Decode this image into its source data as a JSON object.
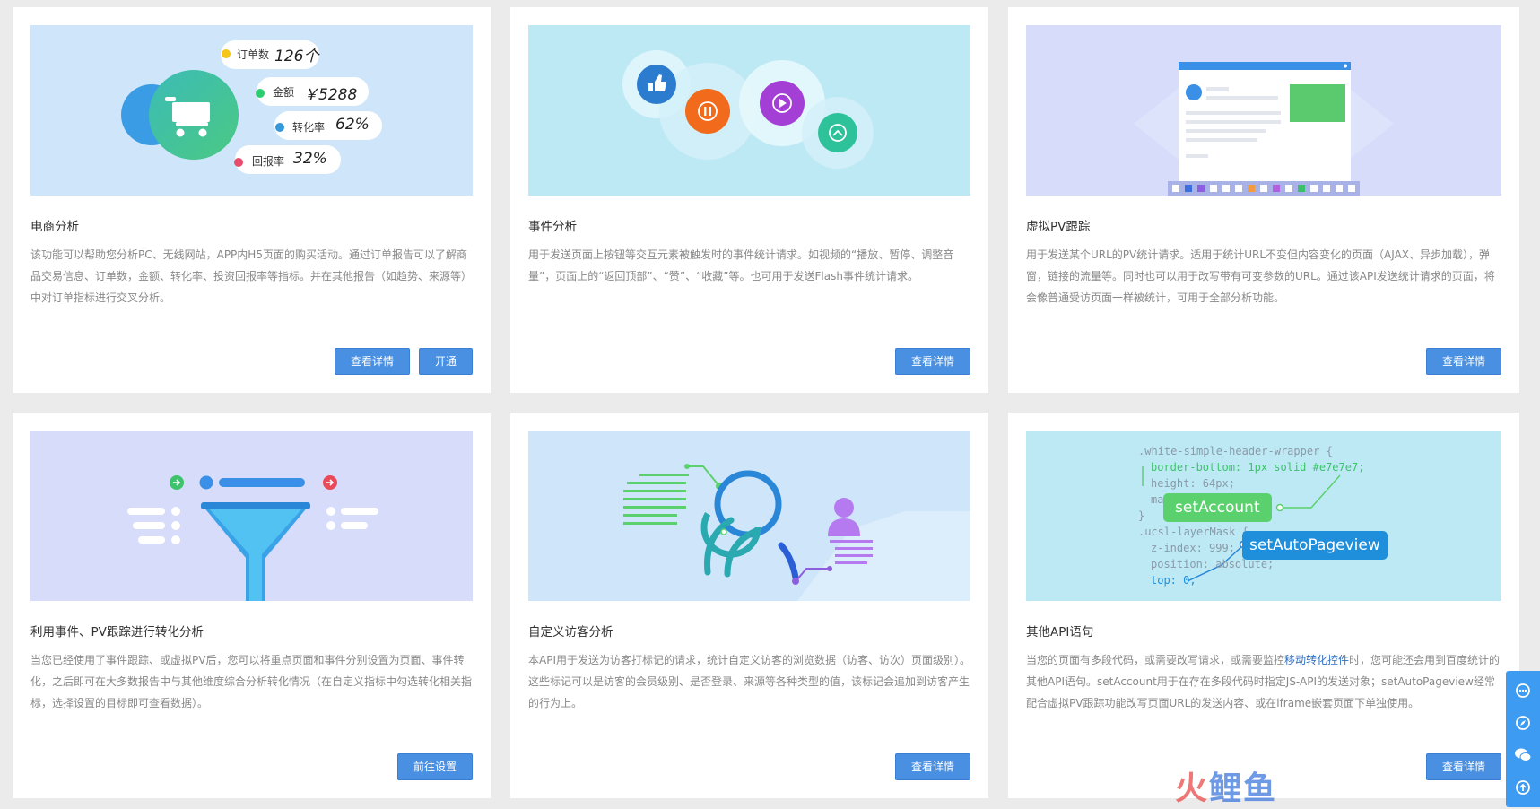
{
  "cards": [
    {
      "title": "电商分析",
      "desc": "该功能可以帮助您分析PC、无线网站，APP内H5页面的购买活动。通过订单报告可以了解商品交易信息、订单数，金额、转化率、投资回报率等指标。并在其他报告（如趋势、来源等）中对订单指标进行交叉分析。",
      "buttons": [
        "查看详情",
        "开通"
      ],
      "illustration": {
        "metrics": [
          {
            "label": "订单数",
            "value": "126个",
            "color": "#f5c518"
          },
          {
            "label": "金额",
            "value": "￥5288",
            "color": "#2ecc71"
          },
          {
            "label": "转化率",
            "value": "62%",
            "color": "#3498db"
          },
          {
            "label": "回报率",
            "value": "32%",
            "color": "#e74c6c"
          }
        ]
      }
    },
    {
      "title": "事件分析",
      "desc": "用于发送页面上按钮等交互元素被触发时的事件统计请求。如视频的“播放、暂停、调整音量”，页面上的“返回顶部”、“赞”、“收藏”等。也可用于发送Flash事件统计请求。",
      "buttons": [
        "查看详情"
      ]
    },
    {
      "title": "虚拟PV跟踪",
      "desc": "用于发送某个URL的PV统计请求。适用于统计URL不变但内容变化的页面（AJAX、异步加载），弹窗，链接的流量等。同时也可以用于改写带有可变参数的URL。通过该API发送统计请求的页面，将会像普通受访页面一样被统计，可用于全部分析功能。",
      "buttons": [
        "查看详情"
      ]
    },
    {
      "title": "利用事件、PV跟踪进行转化分析",
      "desc": "当您已经使用了事件跟踪、或虚拟PV后，您可以将重点页面和事件分别设置为页面、事件转化，之后即可在大多数报告中与其他维度综合分析转化情况（在自定义指标中勾选转化相关指标，选择设置的目标即可查看数据）。",
      "buttons": [
        "前往设置"
      ]
    },
    {
      "title": "自定义访客分析",
      "desc": "本API用于发送为访客打标记的请求，统计自定义访客的浏览数据（访客、访次）页面级别）。这些标记可以是访客的会员级别、是否登录、来源等各种类型的值，该标记会追加到访客产生的行为上。",
      "buttons": [
        "查看详情"
      ]
    },
    {
      "title": "其他API语句",
      "desc_parts": [
        "当您的页面有多段代码，或需要改写请求，或需要监控",
        "移动转化控件",
        "时，您可能还会用到百度统计的其他API语句。setAccount用于在存在多段代码时指定JS-API的发送对象；setAutoPageview经常配合虚拟PV跟踪功能改写页面URL的发送内容、或在iframe嵌套页面下单独使用。"
      ],
      "buttons": [
        "查看详情"
      ],
      "illustration": {
        "code_lines": [
          ".white-simple-header-wrapper {",
          "border-bottom: 1px solid #e7e7e7;",
          "height: 64px;",
          "ma",
          "}",
          ".ucsl-layerMask {",
          "z-index: 999;",
          "position: absolute;",
          "top: 0;"
        ],
        "bubble_1": "setAccount",
        "bubble_2": "setAutoPageview"
      }
    }
  ],
  "watermark": {
    "part1": "火",
    "part2": "鲤鱼"
  },
  "colors": {
    "accent": "#4a90e2",
    "page_bg": "#ebebeb",
    "illus_blue": "#cfe6fa",
    "illus_cyan": "#bde9f5",
    "illus_lavender": "#d6dcfa",
    "green": "#5bd16e",
    "code_blue": "#1f8fdc"
  },
  "side_toolbar": [
    "chat-icon",
    "compass-icon",
    "wechat-icon",
    "back-to-top-icon"
  ]
}
